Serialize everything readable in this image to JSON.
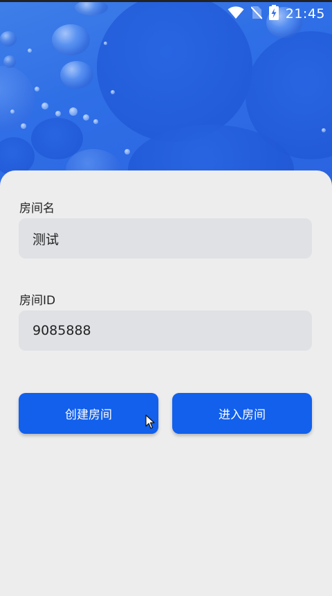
{
  "status_bar": {
    "time": "21:45",
    "icons": [
      "wifi-icon",
      "no-sim-icon",
      "battery-charging-icon"
    ]
  },
  "form": {
    "room_name": {
      "label": "房间名",
      "value": "测试"
    },
    "room_id": {
      "label": "房间ID",
      "value": "9085888"
    }
  },
  "actions": {
    "create_label": "创建房间",
    "join_label": "进入房间"
  },
  "colors": {
    "primary": "#1260ec",
    "header_blue": "#2f6fe6",
    "input_bg": "#dfe1e5",
    "page_bg": "#ededee"
  }
}
